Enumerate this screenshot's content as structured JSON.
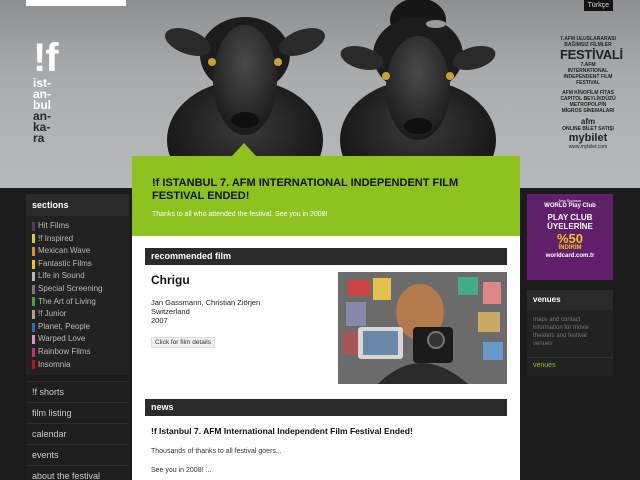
{
  "header": {
    "language_link": "Türkçe",
    "logo": {
      "mark": "!f",
      "city_lines_light": [
        "ist-",
        "an-",
        "bul"
      ],
      "city_lines_dark": [
        "an-",
        "ka-",
        "ra"
      ]
    },
    "festival_badge": {
      "small_lines": [
        "7.AFM ULUSLARARASI",
        "BAĞIMSIZ FİLMLER"
      ],
      "big": "FESTİVALİ",
      "small_lines_2": [
        "7.AFM INTERNATIONAL",
        "INDEPENDENT FILM FESTIVAL"
      ],
      "small_lines_3": [
        "AFM KİNOFİLM FİTAS",
        "CAPITOL BEYLİKDÜZÜ",
        "METROPOLPİN MİGROS SİNEMALARI"
      ],
      "logos": "afm",
      "small_lines_4": [
        "ONLINE BİLET SATIŞI"
      ],
      "mybilet": "mybilet",
      "url": "www.mybilet.com"
    }
  },
  "sidebar": {
    "sections_title": "sections",
    "sections": [
      {
        "label": "Hit Films",
        "color": "#4d3a5c"
      },
      {
        "label": "!f Inspired",
        "color": "#c9d53a"
      },
      {
        "label": "Mexican Wave",
        "color": "#e0911f"
      },
      {
        "label": "Fantastic Films",
        "color": "#e8c52a"
      },
      {
        "label": "Life in Sound",
        "color": "#b8b8b8"
      },
      {
        "label": "Special Screening",
        "color": "#7a7a7a"
      },
      {
        "label": "The Art of Living",
        "color": "#4aa13a"
      },
      {
        "label": "!f Junior",
        "color": "#b6a27a"
      },
      {
        "label": "Planet, People",
        "color": "#2b6fa8"
      },
      {
        "label": "Warped Love",
        "color": "#e88fc0"
      },
      {
        "label": "Rainbow Films",
        "color": "#d62b6b"
      },
      {
        "label": "Insomnia",
        "color": "#b01818"
      }
    ],
    "nav": [
      "!f shorts",
      "film listing",
      "calendar",
      "events",
      "about the festival"
    ]
  },
  "announcement": {
    "title": "!f ISTANBUL 7. AFM INTERNATIONAL INDEPENDENT FILM FESTIVAL ENDED!",
    "subtitle": "Thanks to all who attended the festival. See you in 2008!"
  },
  "recommended": {
    "heading": "recommended film",
    "title": "Chrigu",
    "directors": "Jan Gassmann, Christian Ziörjen",
    "country": "Switzerland",
    "year": "2007",
    "details_button": "Click for film details"
  },
  "news": {
    "heading": "news",
    "title": "!f Istanbul 7. AFM International Independent Film Festival Ended!",
    "text1": "Thousands of thanks to all festival goers...",
    "text2": "See you in 2008! ..."
  },
  "ad": {
    "top": "Ana Sponsor",
    "world": "WORLD  Play Club",
    "line1": "PLAY CLUB",
    "line2": "ÜYELERİNE",
    "percent": "%50",
    "discount": "İNDİRİM",
    "site": "worldcard.com.tr"
  },
  "venues": {
    "title": "venues",
    "text": "maps and contact information for movie theaters and festival venues",
    "link": "venues"
  },
  "colors": {
    "accent_green": "#8dc21f",
    "background": "#1b1b1b",
    "ad_purple": "#611f6b"
  }
}
